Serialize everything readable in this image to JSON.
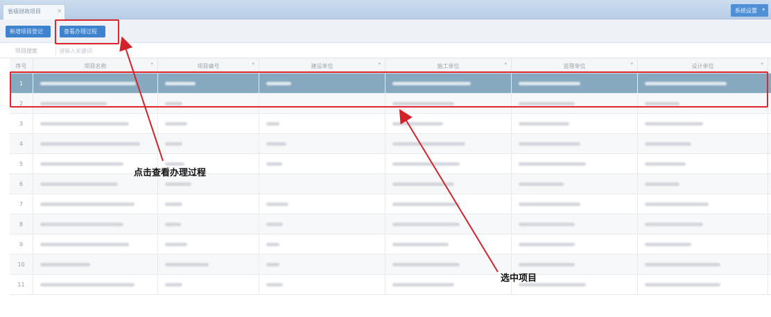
{
  "window": {
    "tab_label": "省级财政项目",
    "tab_close": "×",
    "right_button_label": "系统设置",
    "right_button_caret": "▾"
  },
  "toolbar": {
    "btn1_label": "新增项目登记",
    "btn2_label": "查看办理过程"
  },
  "filter": {
    "label": "项目搜索",
    "placeholder": "请输入关键词"
  },
  "table": {
    "columns": [
      "序号",
      "项目名称",
      "项目编号",
      "建设单位",
      "施工单位",
      "监理单位",
      "设计单位"
    ],
    "rows": [
      {
        "index": "1",
        "selected": true
      },
      {
        "index": "2",
        "selected": false
      },
      {
        "index": "3",
        "selected": false
      },
      {
        "index": "4",
        "selected": false
      },
      {
        "index": "5",
        "selected": false
      },
      {
        "index": "6",
        "selected": false
      },
      {
        "index": "7",
        "selected": false
      },
      {
        "index": "8",
        "selected": false
      },
      {
        "index": "9",
        "selected": false
      },
      {
        "index": "10",
        "selected": false
      },
      {
        "index": "11",
        "selected": false
      }
    ]
  },
  "annotations": {
    "click_hint": "点击查看办理过程",
    "select_hint": "选中项目"
  },
  "colors": {
    "accent": "#3f83cf",
    "selected_row": "#87a9c0",
    "highlight_box": "#e0242b"
  }
}
